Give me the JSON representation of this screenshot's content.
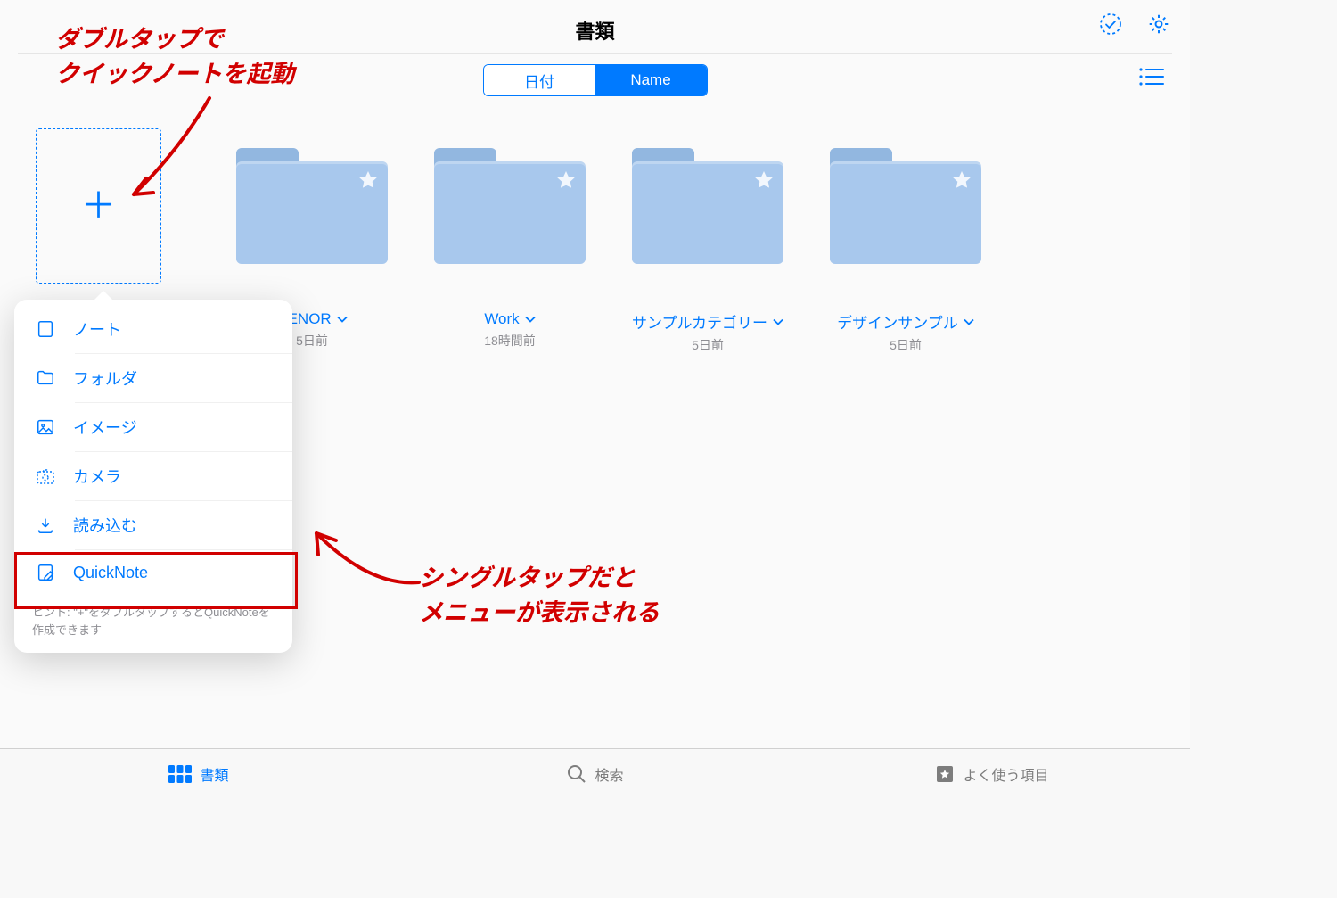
{
  "header": {
    "title": "書類"
  },
  "sort": {
    "date_label": "日付",
    "name_label": "Name"
  },
  "folders": [
    {
      "name": "RENOR",
      "date": "5日前"
    },
    {
      "name": "Work",
      "date": "18時間前"
    },
    {
      "name": "サンプルカテゴリー",
      "date": "5日前"
    },
    {
      "name": "デザインサンプル",
      "date": "5日前"
    }
  ],
  "popover": {
    "items": [
      {
        "label": "ノート"
      },
      {
        "label": "フォルダ"
      },
      {
        "label": "イメージ"
      },
      {
        "label": "カメラ"
      },
      {
        "label": "読み込む"
      },
      {
        "label": "QuickNote"
      }
    ],
    "hint": "ヒント: \"+\"をダブルタップするとQuickNoteを作成できます"
  },
  "annotations": {
    "top": "ダブルタップで\nクイックノートを起動",
    "bottom": "シングルタップだと\nメニューが表示される"
  },
  "tabbar": {
    "docs": "書類",
    "search": "検索",
    "favorites": "よく使う項目"
  }
}
